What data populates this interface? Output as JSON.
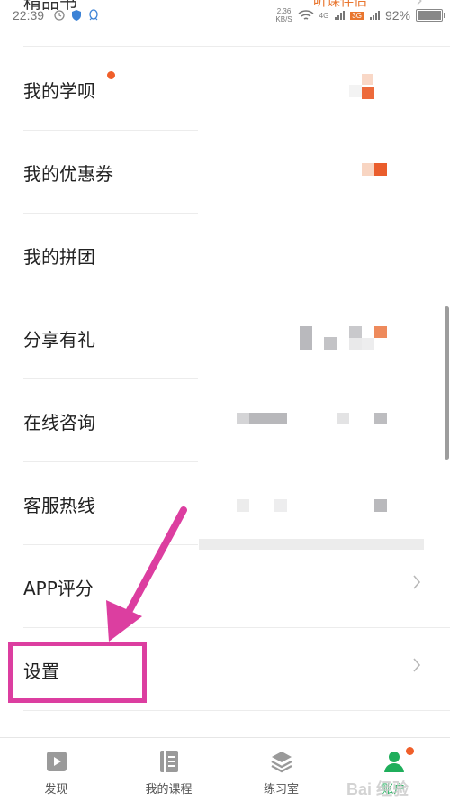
{
  "status_bar": {
    "time": "22:39",
    "net_speed_value": "2.36",
    "net_speed_unit": "KB/S",
    "network_tag_4g": "4G",
    "network_tag_3g": "3G",
    "battery_percent": "92%",
    "battery_level": 0.92
  },
  "top_partial_row": {
    "label": "精品书",
    "right_text": "听课伴侣"
  },
  "menu": {
    "items": [
      {
        "label": "我的学呗",
        "has_dot": true
      },
      {
        "label": "我的优惠券"
      },
      {
        "label": "我的拼团"
      },
      {
        "label": "分享有礼"
      },
      {
        "label": "在线咨询"
      },
      {
        "label": "客服热线"
      },
      {
        "label": "APP评分"
      },
      {
        "label": "设置"
      }
    ]
  },
  "bottom_nav": {
    "items": [
      {
        "label": "发现",
        "icon": "discover-icon"
      },
      {
        "label": "我的课程",
        "icon": "book-icon"
      },
      {
        "label": "练习室",
        "icon": "layers-icon"
      },
      {
        "label": "账户",
        "icon": "account-icon",
        "active": true
      }
    ]
  },
  "watermark": "Bai 经验",
  "colors": {
    "accent_orange": "#f05f2a",
    "active_green": "#1fae5b",
    "annotation_magenta": "#dc3ea0"
  }
}
